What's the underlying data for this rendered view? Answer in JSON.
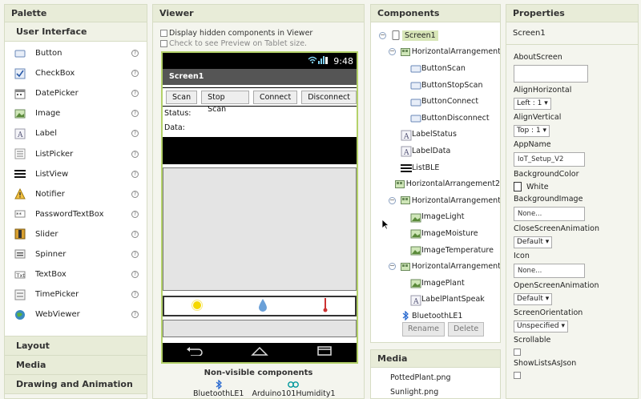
{
  "palette": {
    "title": "Palette",
    "active_category": "User Interface",
    "items": [
      {
        "label": "Button",
        "icon": "button-icon"
      },
      {
        "label": "CheckBox",
        "icon": "checkbox-icon"
      },
      {
        "label": "DatePicker",
        "icon": "datepicker-icon"
      },
      {
        "label": "Image",
        "icon": "image-icon"
      },
      {
        "label": "Label",
        "icon": "label-icon"
      },
      {
        "label": "ListPicker",
        "icon": "listpicker-icon"
      },
      {
        "label": "ListView",
        "icon": "listview-icon"
      },
      {
        "label": "Notifier",
        "icon": "notifier-icon"
      },
      {
        "label": "PasswordTextBox",
        "icon": "password-icon"
      },
      {
        "label": "Slider",
        "icon": "slider-icon"
      },
      {
        "label": "Spinner",
        "icon": "spinner-icon"
      },
      {
        "label": "TextBox",
        "icon": "textbox-icon"
      },
      {
        "label": "TimePicker",
        "icon": "timepicker-icon"
      },
      {
        "label": "WebViewer",
        "icon": "webviewer-icon"
      }
    ],
    "help_glyph": "?",
    "categories": [
      "Layout",
      "Media",
      "Drawing and Animation"
    ]
  },
  "viewer": {
    "title": "Viewer",
    "opt_hidden": "Display hidden components in Viewer",
    "opt_tablet": "Check to see Preview on Tablet size.",
    "status_time": "9:48",
    "screen_title": "Screen1",
    "buttons": [
      "Scan",
      "Stop Scan",
      "Connect",
      "Disconnect"
    ],
    "label_status": "Status:",
    "label_data": "Data:",
    "nonvisible_title": "Non-visible components",
    "nonvisible": [
      {
        "label": "BluetoothLE1",
        "icon": "bluetooth-icon"
      },
      {
        "label": "Arduino101Humidity1",
        "icon": "arduino-icon"
      }
    ]
  },
  "components": {
    "title": "Components",
    "tree": [
      {
        "label": "Screen1",
        "depth": 0,
        "toggle": "−",
        "icon": "screen-icon",
        "selected": true
      },
      {
        "label": "HorizontalArrangement1",
        "depth": 1,
        "toggle": "−",
        "icon": "arrangement-icon"
      },
      {
        "label": "ButtonScan",
        "depth": 2,
        "icon": "button-icon"
      },
      {
        "label": "ButtonStopScan",
        "depth": 2,
        "icon": "button-icon"
      },
      {
        "label": "ButtonConnect",
        "depth": 2,
        "icon": "button-icon"
      },
      {
        "label": "ButtonDisconnect",
        "depth": 2,
        "icon": "button-icon"
      },
      {
        "label": "LabelStatus",
        "depth": 1,
        "icon": "label-icon"
      },
      {
        "label": "LabelData",
        "depth": 1,
        "icon": "label-icon"
      },
      {
        "label": "ListBLE",
        "depth": 1,
        "icon": "listview-icon"
      },
      {
        "label": "HorizontalArrangement2",
        "depth": 1,
        "icon": "arrangement-icon"
      },
      {
        "label": "HorizontalArrangement3",
        "depth": 1,
        "toggle": "−",
        "icon": "arrangement-icon"
      },
      {
        "label": "ImageLight",
        "depth": 2,
        "icon": "image-icon"
      },
      {
        "label": "ImageMoisture",
        "depth": 2,
        "icon": "image-icon"
      },
      {
        "label": "ImageTemperature",
        "depth": 2,
        "icon": "image-icon"
      },
      {
        "label": "HorizontalArrangement4",
        "depth": 1,
        "toggle": "−",
        "icon": "arrangement-icon"
      },
      {
        "label": "ImagePlant",
        "depth": 2,
        "icon": "image-icon"
      },
      {
        "label": "LabelPlantSpeak",
        "depth": 2,
        "icon": "label-icon"
      },
      {
        "label": "BluetoothLE1",
        "depth": 1,
        "icon": "bluetooth-icon"
      }
    ],
    "rename_label": "Rename",
    "delete_label": "Delete"
  },
  "media": {
    "title": "Media",
    "files": [
      "PottedPlant.png",
      "Sunlight.png"
    ]
  },
  "properties": {
    "title": "Properties",
    "component": "Screen1",
    "about_screen": "AboutScreen",
    "align_horizontal": "AlignHorizontal",
    "align_horizontal_value": "Left : 1 ▾",
    "align_vertical": "AlignVertical",
    "align_vertical_value": "Top : 1 ▾",
    "app_name": "AppName",
    "app_name_value": "IoT_Setup_V2",
    "background_color": "BackgroundColor",
    "background_color_value": "White",
    "background_image": "BackgroundImage",
    "background_image_value": "None...",
    "close_anim": "CloseScreenAnimation",
    "close_anim_value": "Default ▾",
    "icon": "Icon",
    "icon_value": "None...",
    "open_anim": "OpenScreenAnimation",
    "open_anim_value": "Default ▾",
    "orientation": "ScreenOrientation",
    "orientation_value": "Unspecified ▾",
    "scrollable": "Scrollable",
    "show_lists": "ShowListsAsJson"
  },
  "colors": {
    "accent_green": "#b4d26a",
    "header_bg": "#e8ecd8",
    "selection": "#d8e6b8"
  }
}
